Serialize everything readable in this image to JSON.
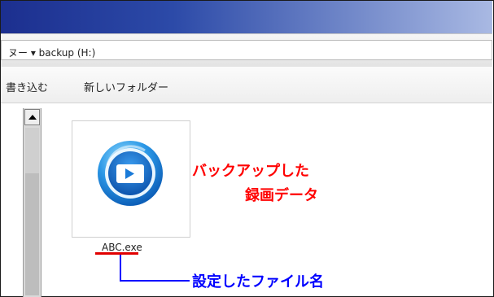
{
  "address": {
    "path_text": "ヌー ▾ backup (H:)"
  },
  "toolbar": {
    "burn_label": "書き込む",
    "new_folder_label": "新しいフォルダー"
  },
  "file": {
    "name": "ABC.exe",
    "icon": "media-player-icon"
  },
  "annotations": {
    "recorded_line1": "バックアップした",
    "recorded_line2": "録画データ",
    "filename_note": "設定したファイル名"
  },
  "colors": {
    "annotation_red": "#ff0000",
    "annotation_blue": "#0000ff",
    "titlebar_blue": "#1c2f8f"
  }
}
